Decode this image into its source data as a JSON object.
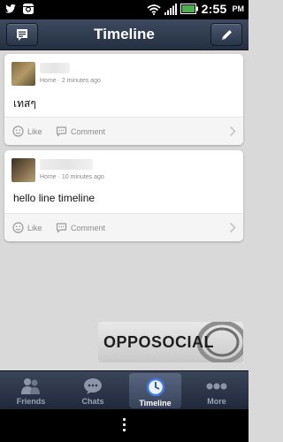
{
  "status_bar": {
    "time": "2:55",
    "ampm": "PM",
    "icons_left": [
      "twitter-icon",
      "instagram-icon"
    ],
    "icons_right": [
      "wifi-icon",
      "signal-icon",
      "battery-icon"
    ],
    "accent_green": "#4caf50"
  },
  "header": {
    "title": "Timeline",
    "left_button_icon": "note-icon",
    "right_button_icon": "compose-icon"
  },
  "posts": [
    {
      "meta": "Home · 2 minutes ago",
      "text": "เทสๆ",
      "like_label": "Like",
      "comment_label": "Comment"
    },
    {
      "meta": "Home · 10 minutes ago",
      "text": "hello line timeline",
      "like_label": "Like",
      "comment_label": "Comment"
    }
  ],
  "watermark": {
    "text": "OPPOSOCIAL"
  },
  "tabs": [
    {
      "label": "Friends",
      "icon": "friends-icon",
      "active": false
    },
    {
      "label": "Chats",
      "icon": "chat-bubble-icon",
      "active": false
    },
    {
      "label": "Timeline",
      "icon": "clock-icon",
      "active": true
    },
    {
      "label": "More",
      "icon": "more-dots-icon",
      "active": false
    }
  ],
  "system_bar": {
    "icon": "menu-dots-icon"
  }
}
